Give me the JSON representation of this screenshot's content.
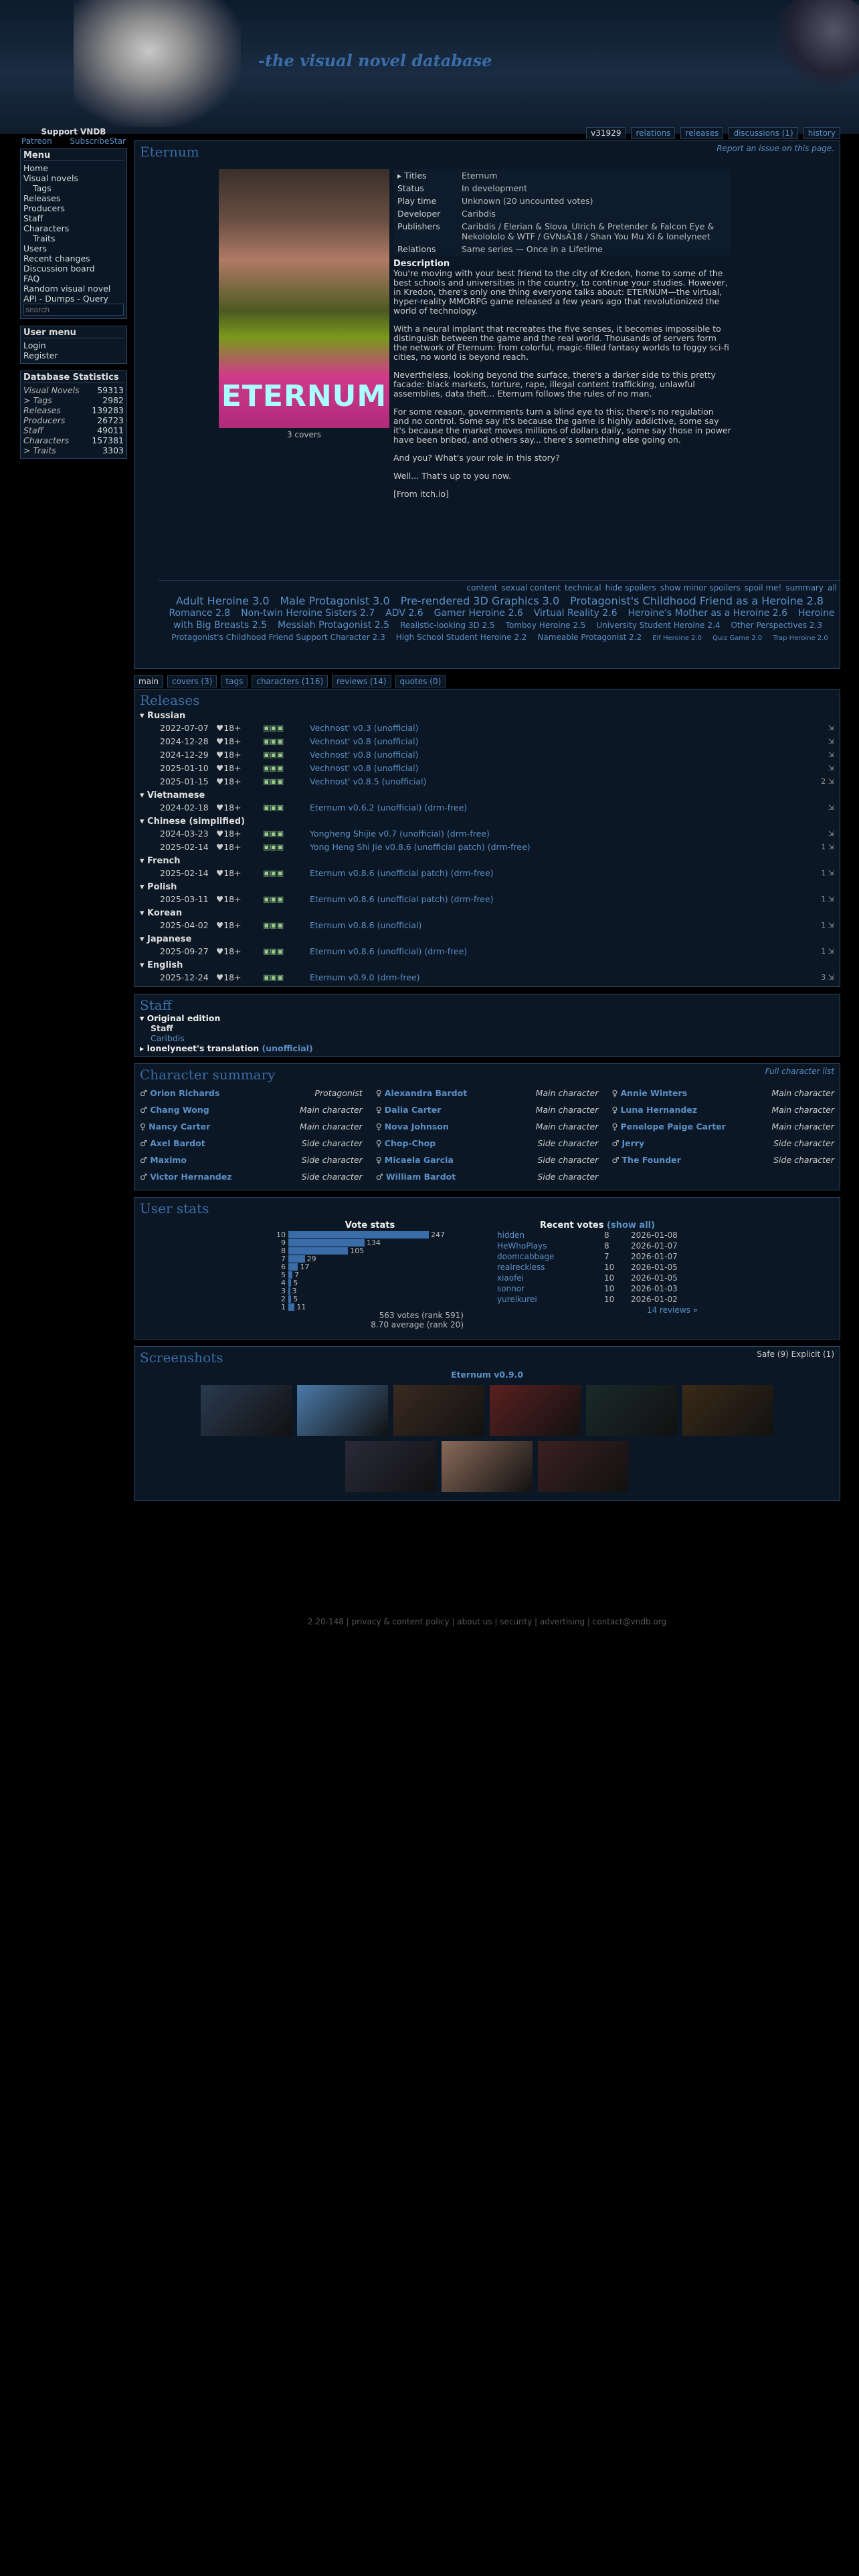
{
  "site_title": "-the visual novel database",
  "sidebar": {
    "support": "Support VNDB",
    "patreon": "Patreon",
    "subscribestar": "SubscribeStar",
    "menu_title": "Menu",
    "menu": [
      "Home",
      "Visual novels",
      "> Tags",
      "Releases",
      "Producers",
      "Staff",
      "Characters",
      "> Traits",
      "Users",
      "Recent changes",
      "Discussion board",
      "FAQ",
      "Random visual novel",
      "API - Dumps - Query"
    ],
    "search_placeholder": "search",
    "user_menu_title": "User menu",
    "user_menu": [
      "Login",
      "Register"
    ],
    "stats_title": "Database Statistics",
    "stats": [
      [
        "Visual Novels",
        "59313"
      ],
      [
        "> Tags",
        "2982"
      ],
      [
        "Releases",
        "139283"
      ],
      [
        "Producers",
        "26723"
      ],
      [
        "Staff",
        "49011"
      ],
      [
        "Characters",
        "157381"
      ],
      [
        "> Traits",
        "3303"
      ]
    ]
  },
  "tabs": [
    "v31929",
    "relations",
    "releases",
    "discussions (1)",
    "history"
  ],
  "vn": {
    "title": "Eternum",
    "report": "Report an issue on this page.",
    "cover_logo": "ETERNUM",
    "covers_label": "3 covers",
    "info": [
      [
        "▸ Titles",
        "Eternum"
      ],
      [
        "Status",
        "In development"
      ],
      [
        "Play time",
        "Unknown (20 uncounted votes)"
      ],
      [
        "Developer",
        "Caribdis"
      ],
      [
        "Publishers",
        "Caribdis / Elerian & Slova_Ulrich & Pretender & Falcon Eye & Nekolololo & WTF / GVNsA18 / Shan You Mu Xi & lonelyneet"
      ],
      [
        "Relations",
        "Same series — Once in a Lifetime"
      ]
    ],
    "description_title": "Description",
    "description": [
      "You're moving with your best friend to the city of Kredon, home to some of the best schools and universities in the country, to continue your studies. However, in Kredon, there's only one thing everyone talks about: ETERNUM—the virtual, hyper-reality MMORPG game released a few years ago that revolutionized the world of technology.",
      "With a neural implant that recreates the five senses, it becomes impossible to distinguish between the game and the real world. Thousands of servers form the network of Eternum: from colorful, magic-filled fantasy worlds to foggy sci-fi cities, no world is beyond reach.",
      "Nevertheless, looking beyond the surface, there's a darker side to this pretty facade: black markets, torture, rape, illegal content trafficking, unlawful assemblies, data theft... Eternum follows the rules of no man.",
      "For some reason, governments turn a blind eye to this; there's no regulation and no control. Some say it's because the game is highly addictive, some say it's because the market moves millions of dollars daily, some say those in power have been bribed, and others say... there's something else going on.",
      "And you? What's your role in this story?",
      "Well... That's up to you now.",
      "[From itch.io]"
    ],
    "tag_cats": [
      "content",
      "sexual content",
      "technical",
      "hide spoilers",
      "show minor spoilers",
      "spoil me!",
      "summary",
      "all"
    ],
    "tags": [
      "Adult Heroine 3.0",
      "Male Protagonist 3.0",
      "Pre-rendered 3D Graphics 3.0",
      "Protagonist's Childhood Friend as a Heroine 2.8",
      "Romance 2.8",
      "Non-twin Heroine Sisters 2.7",
      "ADV 2.6",
      "Gamer Heroine 2.6",
      "Virtual Reality 2.6",
      "Heroine's Mother as a Heroine 2.6",
      "Heroine with Big Breasts 2.5",
      "Messiah Protagonist 2.5",
      "Realistic-looking 3D 2.5",
      "Tomboy Heroine 2.5",
      "University Student Heroine 2.4",
      "Other Perspectives 2.3",
      "Protagonist's Childhood Friend Support Character 2.3",
      "High School Student Heroine 2.2",
      "Nameable Protagonist 2.2",
      "Elf Heroine 2.0",
      "Quiz Game 2.0",
      "Trap Heroine 2.0"
    ]
  },
  "releases": {
    "title": "Releases",
    "subtabs": [
      "main",
      "covers (3)",
      "tags",
      "characters (116)",
      "reviews (14)",
      "quotes (0)"
    ],
    "groups": [
      {
        "lang": "Russian",
        "rows": [
          [
            "2022-07-07",
            "18+",
            "Vechnost' v0.3 (unofficial)",
            ""
          ],
          [
            "2024-12-28",
            "18+",
            "Vechnost' v0.8 (unofficial)",
            ""
          ],
          [
            "2024-12-29",
            "18+",
            "Vechnost' v0.8 (unofficial)",
            ""
          ],
          [
            "2025-01-10",
            "18+",
            "Vechnost' v0.8 (unofficial)",
            ""
          ],
          [
            "2025-01-15",
            "18+",
            "Vechnost' v0.8.5 (unofficial)",
            "2"
          ]
        ]
      },
      {
        "lang": "Vietnamese",
        "rows": [
          [
            "2024-02-18",
            "18+",
            "Eternum v0.6.2 (unofficial) (drm-free)",
            ""
          ]
        ]
      },
      {
        "lang": "Chinese (simplified)",
        "rows": [
          [
            "2024-03-23",
            "18+",
            "Yongheng Shijie v0.7 (unofficial) (drm-free)",
            ""
          ],
          [
            "2025-02-14",
            "18+",
            "Yong Heng Shi Jie v0.8.6 (unofficial patch) (drm-free)",
            "1"
          ]
        ]
      },
      {
        "lang": "French",
        "rows": [
          [
            "2025-02-14",
            "18+",
            "Eternum v0.8.6 (unofficial patch) (drm-free)",
            "1"
          ]
        ]
      },
      {
        "lang": "Polish",
        "rows": [
          [
            "2025-03-11",
            "18+",
            "Eternum v0.8.6 (unofficial patch) (drm-free)",
            "1"
          ]
        ]
      },
      {
        "lang": "Korean",
        "rows": [
          [
            "2025-04-02",
            "18+",
            "Eternum v0.8.6 (unofficial)",
            "1"
          ]
        ]
      },
      {
        "lang": "Japanese",
        "rows": [
          [
            "2025-09-27",
            "18+",
            "Eternum v0.8.6 (unofficial) (drm-free)",
            "1"
          ]
        ]
      },
      {
        "lang": "English",
        "rows": [
          [
            "2025-12-24",
            "18+",
            "Eternum v0.9.0 (drm-free)",
            "3"
          ]
        ]
      }
    ]
  },
  "staff": {
    "title": "Staff",
    "original": "Original edition",
    "staff_label": "Staff",
    "staff_name": "Caribdis",
    "translation": "lonelyneet's translation",
    "translation_tag": "(unofficial)"
  },
  "characters": {
    "title": "Character summary",
    "full_link": "Full character list",
    "list": [
      [
        "♂",
        "Orion Richards",
        "Protagonist"
      ],
      [
        "♀",
        "Alexandra Bardot",
        "Main character"
      ],
      [
        "♀",
        "Annie Winters",
        "Main character"
      ],
      [
        "♂",
        "Chang Wong",
        "Main character"
      ],
      [
        "♀",
        "Dalia Carter",
        "Main character"
      ],
      [
        "♀",
        "Luna Hernandez",
        "Main character"
      ],
      [
        "♀",
        "Nancy Carter",
        "Main character"
      ],
      [
        "♀",
        "Nova Johnson",
        "Main character"
      ],
      [
        "♀",
        "Penelope Paige Carter",
        "Main character"
      ],
      [
        "♂",
        "Axel Bardot",
        "Side character"
      ],
      [
        "♀",
        "Chop-Chop",
        "Side character"
      ],
      [
        "♂",
        "Jerry",
        "Side character"
      ],
      [
        "♂",
        "Maximo",
        "Side character"
      ],
      [
        "♀",
        "Micaela Garcia",
        "Side character"
      ],
      [
        "♂",
        "The Founder",
        "Side character"
      ],
      [
        "♂",
        "Victor Hernandez",
        "Side character"
      ],
      [
        "♂",
        "William Bardot",
        "Side character"
      ]
    ]
  },
  "userstats": {
    "title": "User stats",
    "vote_title": "Vote stats",
    "votes": [
      [
        "10",
        "247"
      ],
      [
        "9",
        "134"
      ],
      [
        "8",
        "105"
      ],
      [
        "7",
        "29"
      ],
      [
        "6",
        "17"
      ],
      [
        "5",
        "7"
      ],
      [
        "4",
        "5"
      ],
      [
        "3",
        "3"
      ],
      [
        "2",
        "5"
      ],
      [
        "1",
        "11"
      ]
    ],
    "summary1": "563 votes (rank 591)",
    "summary2": "8.70 average (rank 20)",
    "recent_title": "Recent votes",
    "show_all": "(show all)",
    "recent": [
      [
        "hidden",
        "8",
        "2026-01-08"
      ],
      [
        "HeWhoPlays",
        "8",
        "2026-01-07"
      ],
      [
        "doomcabbage",
        "7",
        "2026-01-07"
      ],
      [
        "realreckless",
        "10",
        "2026-01-05"
      ],
      [
        "xiaofei",
        "10",
        "2026-01-05"
      ],
      [
        "sonnor",
        "10",
        "2026-01-03"
      ],
      [
        "yureikurei",
        "10",
        "2026-01-02"
      ]
    ],
    "reviews": "14 reviews »"
  },
  "screenshots": {
    "title": "Screenshots",
    "filters": "Safe (9)  Explicit (1)",
    "release": "Eternum v0.9.0"
  },
  "footer": "2.20-148 | privacy & content policy | about us | security | advertising | contact@vndb.org"
}
